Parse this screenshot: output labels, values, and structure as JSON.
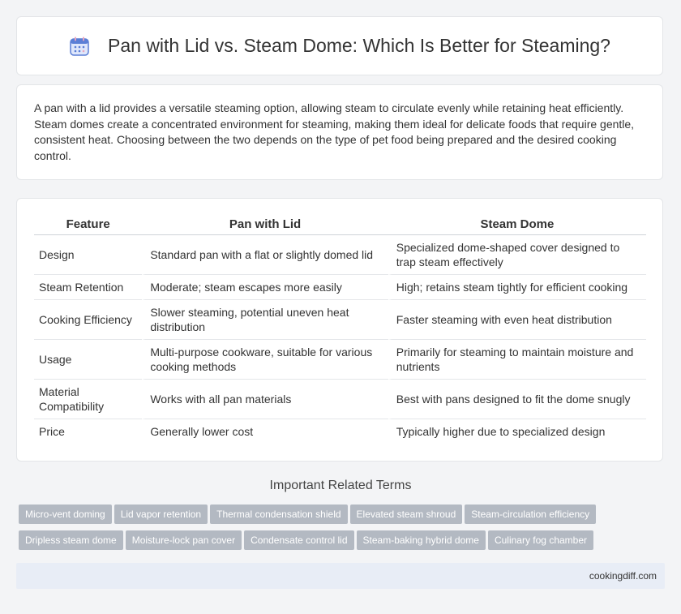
{
  "header": {
    "title": "Pan with Lid vs. Steam Dome: Which Is Better for Steaming?",
    "icon": "calendar-icon"
  },
  "intro": {
    "text": "A pan with a lid provides a versatile steaming option, allowing steam to circulate evenly while retaining heat efficiently. Steam domes create a concentrated environment for steaming, making them ideal for delicate foods that require gentle, consistent heat. Choosing between the two depends on the type of pet food being prepared and the desired cooking control."
  },
  "table": {
    "headers": [
      "Feature",
      "Pan with Lid",
      "Steam Dome"
    ],
    "rows": [
      [
        "Design",
        "Standard pan with a flat or slightly domed lid",
        "Specialized dome-shaped cover designed to trap steam effectively"
      ],
      [
        "Steam Retention",
        "Moderate; steam escapes more easily",
        "High; retains steam tightly for efficient cooking"
      ],
      [
        "Cooking Efficiency",
        "Slower steaming, potential uneven heat distribution",
        "Faster steaming with even heat distribution"
      ],
      [
        "Usage",
        "Multi-purpose cookware, suitable for various cooking methods",
        "Primarily for steaming to maintain moisture and nutrients"
      ],
      [
        "Material Compatibility",
        "Works with all pan materials",
        "Best with pans designed to fit the dome snugly"
      ],
      [
        "Price",
        "Generally lower cost",
        "Typically higher due to specialized design"
      ]
    ]
  },
  "related": {
    "title": "Important Related Terms",
    "tags": [
      "Micro-vent doming",
      "Lid vapor retention",
      "Thermal condensation shield",
      "Elevated steam shroud",
      "Steam-circulation efficiency",
      "Dripless steam dome",
      "Moisture-lock pan cover",
      "Condensate control lid",
      "Steam-baking hybrid dome",
      "Culinary fog chamber"
    ]
  },
  "footer": {
    "site": "cookingdiff.com"
  },
  "colors": {
    "tag_bg": "#b3b9c2",
    "footer_bg": "#e8edf6",
    "icon_blue": "#5b7fd6",
    "icon_pink": "#e8a5c0"
  }
}
